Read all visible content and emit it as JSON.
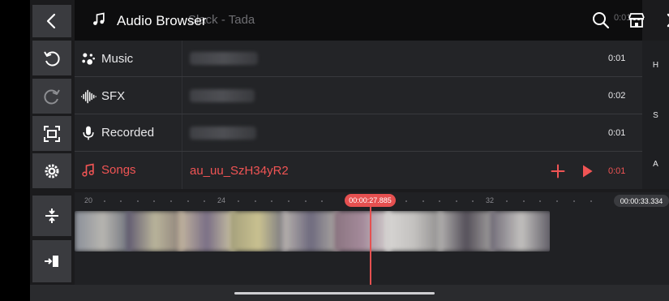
{
  "header": {
    "title": "Audio Browser",
    "ghost_title": "Slack - Tada",
    "ghost_duration": "0:01"
  },
  "tools": {
    "back": "back-arrow-icon",
    "undo": "undo-icon",
    "redo": "redo-icon",
    "fit": "fit-screen-icon",
    "settings": "gear-icon",
    "adjust": "adjust-layers-icon",
    "export": "insert-icon"
  },
  "categories": [
    {
      "label": "Music",
      "icon": "music-cluster-icon"
    },
    {
      "label": "SFX",
      "icon": "waveform-icon"
    },
    {
      "label": "Recorded",
      "icon": "microphone-icon"
    },
    {
      "label": "Songs",
      "icon": "music-note-icon"
    }
  ],
  "rows": [
    {
      "name": "",
      "blurred": true,
      "duration": "0:01"
    },
    {
      "name": "",
      "blurred": true,
      "duration": "0:02"
    },
    {
      "name": "",
      "blurred": true,
      "duration": "0:01"
    },
    {
      "name": "au_uu_SzH34yR2",
      "blurred": false,
      "duration": "0:01"
    }
  ],
  "index_letters": [
    "H",
    "S",
    "A"
  ],
  "timeline": {
    "ruler_labels": [
      "20",
      "24",
      "32"
    ],
    "current_time": "00:00:27.885",
    "total_time": "00:00:33.334"
  },
  "colors": {
    "accent": "#f05454",
    "panel": "#232427",
    "header": "#0d0d0e",
    "tool_button": "#3a3b3f"
  }
}
